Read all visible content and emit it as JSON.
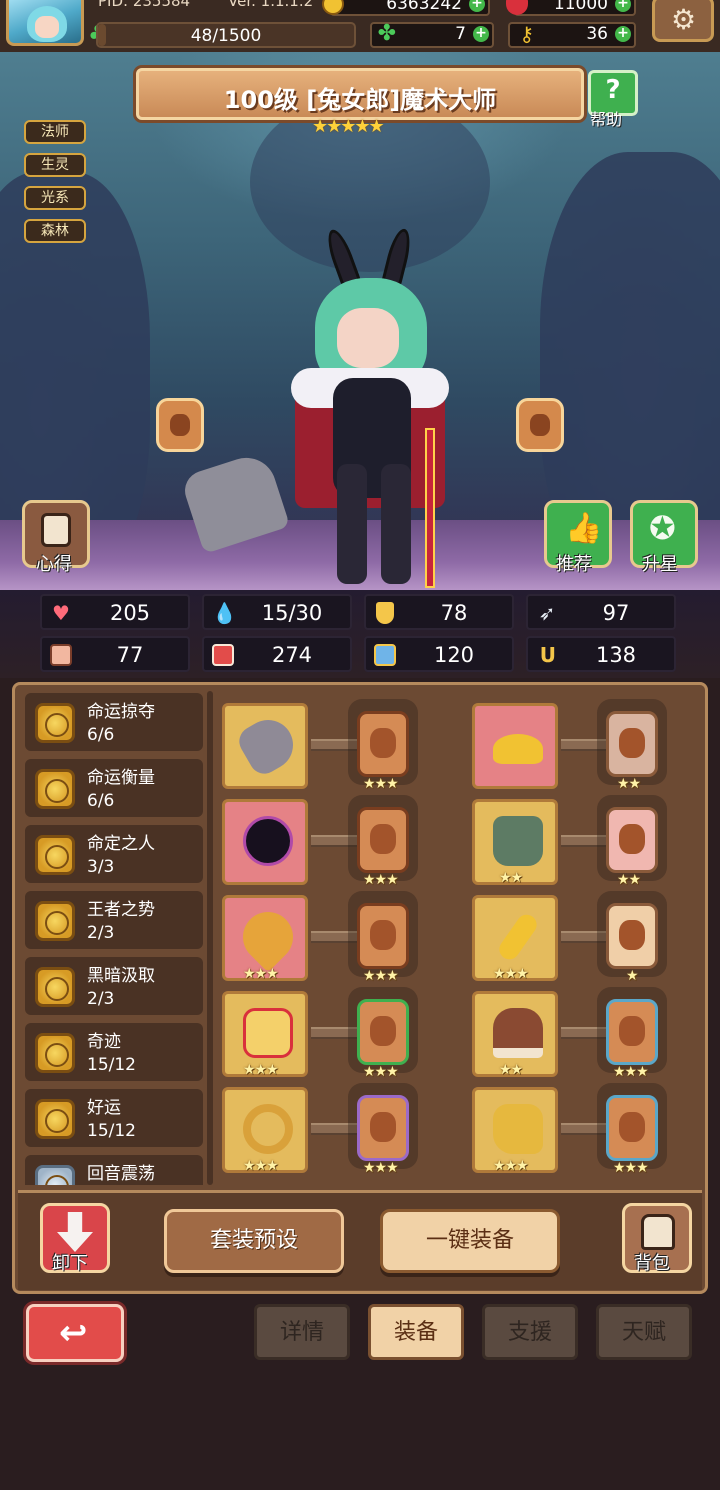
{
  "top": {
    "pid": "PID: 235584",
    "version": "Ver. 1.1.1.2",
    "gold": "6363242",
    "gems": "11000",
    "energy": "48/1500",
    "energy_fraction": 0.032,
    "clover_count": "7",
    "key_count": "36"
  },
  "hero": {
    "tags": [
      "法师",
      "生灵",
      "光系",
      "森林"
    ],
    "title": "100级 [兔女郎]魔术大师",
    "stars": "★★★★★",
    "help": "帮助",
    "xinde": "心得",
    "tuijian": "推荐",
    "shengxing": "升星"
  },
  "stats": {
    "hp": "205",
    "mana": "15/30",
    "defense": "78",
    "speed": "97",
    "attack": "77",
    "magic": "274",
    "armor": "120",
    "luck": "138"
  },
  "sets": [
    {
      "name": "命运掠夺",
      "count": "6/6"
    },
    {
      "name": "命运衡量",
      "count": "6/6"
    },
    {
      "name": "命定之人",
      "count": "3/3"
    },
    {
      "name": "王者之势",
      "count": "2/3"
    },
    {
      "name": "黑暗汲取",
      "count": "2/3"
    },
    {
      "name": "奇迹",
      "count": "15/12"
    },
    {
      "name": "好运",
      "count": "15/12"
    },
    {
      "name": "回音震荡",
      "count": ""
    }
  ],
  "slots": {
    "r1l": {
      "stars": "",
      "card_stars": "★★★"
    },
    "r1r": {
      "stars": "",
      "card_stars": "★★"
    },
    "r2l": {
      "stars": "",
      "card_stars": "★★★"
    },
    "r2r": {
      "stars": "★★",
      "card_stars": "★★"
    },
    "r3l": {
      "stars": "★★★",
      "card_stars": "★★★"
    },
    "r3r": {
      "stars": "★★★",
      "card_stars": "★"
    },
    "r4l": {
      "stars": "★★★",
      "card_stars": "★★★"
    },
    "r4r": {
      "stars": "★★",
      "card_stars": "★★★"
    },
    "r5l": {
      "stars": "★★★",
      "card_stars": "★★★"
    },
    "r5r": {
      "stars": "★★★",
      "card_stars": "★★★"
    }
  },
  "actions": {
    "unequip": "卸下",
    "preset": "套装预设",
    "equip_all": "一键装备",
    "bag": "背包"
  },
  "tabs": [
    "详情",
    "装备",
    "支援",
    "天赋"
  ],
  "active_tab": "装备",
  "colors": {
    "accent_gold": "#d6a53f",
    "tab_active": "#f1d2a7",
    "back_red": "#e24c4a",
    "plus_green": "#43b84a"
  }
}
